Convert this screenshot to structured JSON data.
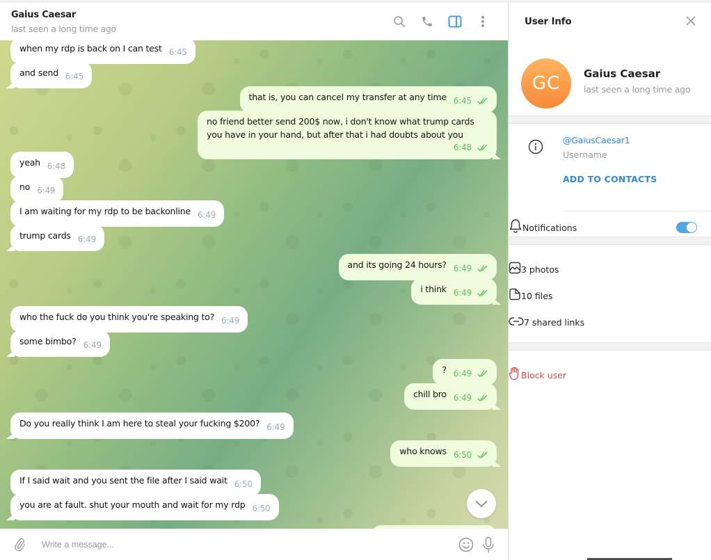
{
  "chat": {
    "title": "Gaius Caesar",
    "status": "last seen a long time ago",
    "header_icons": [
      "search-icon",
      "phone-icon",
      "sidebar-toggle-icon",
      "more-vertical-icon"
    ],
    "messages": [
      {
        "dir": "in",
        "text": "when my rdp is back on I can test",
        "time": "6:45"
      },
      {
        "dir": "in",
        "text": "and send",
        "time": "6:45"
      },
      {
        "dir": "out",
        "text": "that is, you can cancel my transfer at any time",
        "time": "6:45",
        "read": true
      },
      {
        "dir": "out",
        "text": "no friend better send 200$ now, i don't know what trump cards you have in your hand, but after that i had doubts about you",
        "time": "6:48",
        "read": true
      },
      {
        "dir": "in",
        "text": "yeah",
        "time": "6:48"
      },
      {
        "dir": "in",
        "text": "no",
        "time": "6:49"
      },
      {
        "dir": "in",
        "text": "I am waiting for my rdp to be backonline",
        "time": "6:49"
      },
      {
        "dir": "in",
        "text": "trump cards",
        "time": "6:49"
      },
      {
        "dir": "out",
        "text": "and its going 24 hours?",
        "time": "6:49",
        "read": true
      },
      {
        "dir": "out",
        "text": "i think",
        "time": "6:49",
        "read": true
      },
      {
        "dir": "in",
        "text": "who the fuck do you think you're speaking to?",
        "time": "6:49"
      },
      {
        "dir": "in",
        "text": "some bimbo?",
        "time": "6:49"
      },
      {
        "dir": "out",
        "text": "?",
        "time": "6:49",
        "read": true
      },
      {
        "dir": "out",
        "text": "chill bro",
        "time": "6:49",
        "read": true
      },
      {
        "dir": "in",
        "text": "Do you really think I am here to steal your fucking $200?",
        "time": "6:49"
      },
      {
        "dir": "out",
        "text": "who knows",
        "time": "6:50",
        "read": true
      },
      {
        "dir": "in",
        "text": "If I said wait and you sent the file after I said wait",
        "time": "6:50"
      },
      {
        "dir": "in",
        "text": "you are at fault. shut your mouth and wait for my rdp",
        "time": "6:50"
      }
    ],
    "composer": {
      "placeholder": "Write a message..."
    }
  },
  "user_info": {
    "title": "User Info",
    "avatar_initials": "GC",
    "name": "Gaius Caesar",
    "status": "last seen a long time ago",
    "username": "@GaiusCaesar1",
    "username_label": "Username",
    "add_contacts_label": "ADD TO CONTACTS",
    "notifications_label": "Notifications",
    "notifications_enabled": true,
    "media": [
      {
        "icon": "photo-icon",
        "label": "3 photos"
      },
      {
        "icon": "file-icon",
        "label": "10 files"
      },
      {
        "icon": "link-icon",
        "label": "7 shared links"
      }
    ],
    "block_label": "Block user"
  },
  "colors": {
    "accent": "#2f8cd3",
    "out_bubble": "#effdde",
    "out_meta": "#5fbb62",
    "danger": "#d14e4e",
    "avatar": "#f7893a"
  }
}
